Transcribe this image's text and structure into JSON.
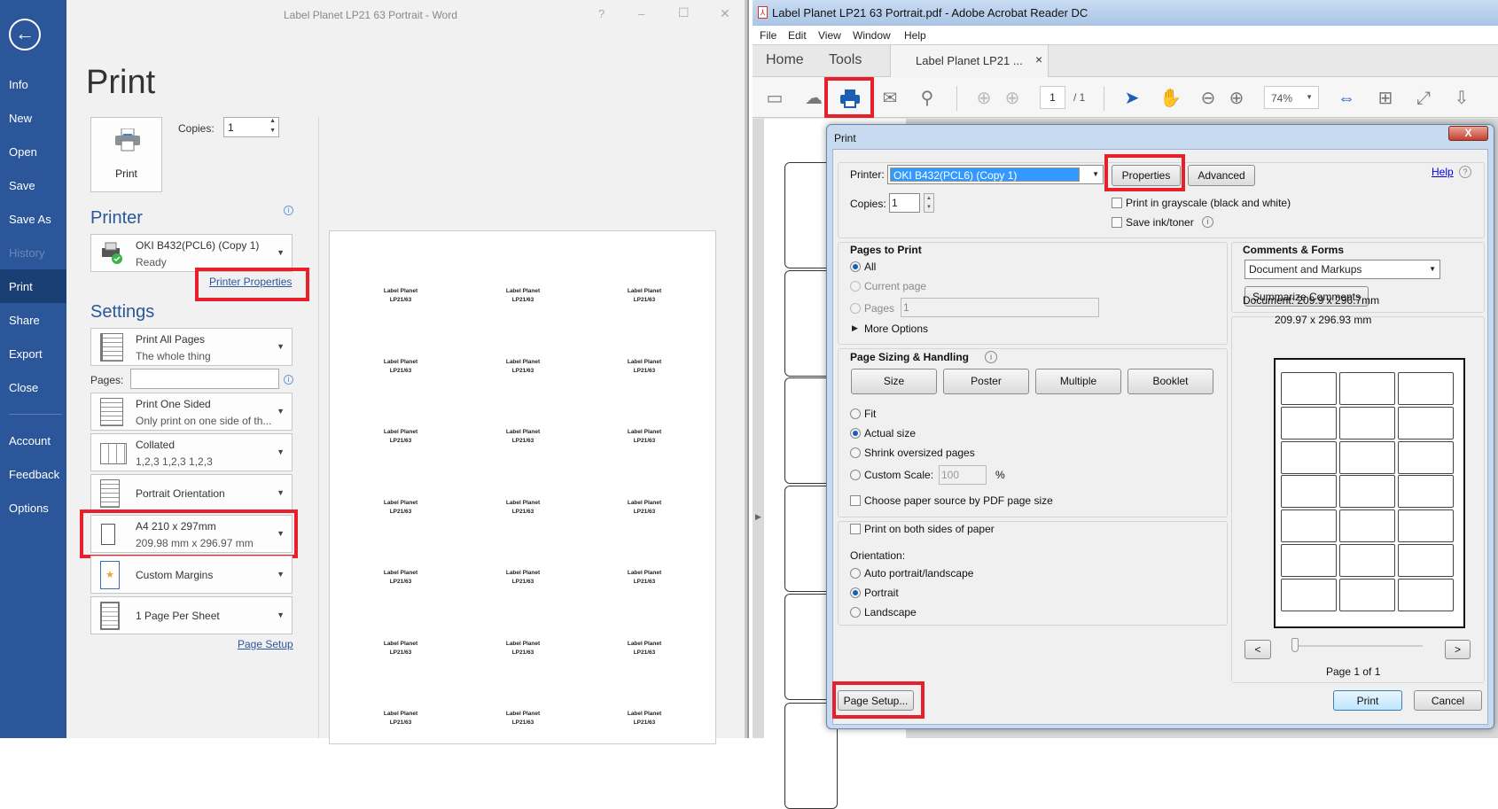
{
  "word": {
    "title": "Label Planet LP21 63 Portrait  -  Word",
    "window_buttons": {
      "help": "?",
      "minimize": "–",
      "maximize": "☐",
      "close": "✕"
    },
    "sidebar": [
      {
        "label": "Info"
      },
      {
        "label": "New"
      },
      {
        "label": "Open"
      },
      {
        "label": "Save"
      },
      {
        "label": "Save As"
      },
      {
        "label": "History"
      },
      {
        "label": "Print"
      },
      {
        "label": "Share"
      },
      {
        "label": "Export"
      },
      {
        "label": "Close"
      },
      {
        "label": "Account"
      },
      {
        "label": "Feedback"
      },
      {
        "label": "Options"
      }
    ],
    "heading": "Print",
    "print_button": "Print",
    "copies_label": "Copies:",
    "copies_value": "1",
    "printer_heading": "Printer",
    "printer_name": "OKI B432(PCL6) (Copy 1)",
    "printer_status": "Ready",
    "printer_properties": "Printer Properties",
    "settings_heading": "Settings",
    "pages_label": "Pages:",
    "pages_value": "",
    "settings": [
      {
        "title": "Print All Pages",
        "sub": "The whole thing"
      },
      {
        "title": "Print One Sided",
        "sub": "Only print on one side of th..."
      },
      {
        "title": "Collated",
        "sub": "1,2,3    1,2,3    1,2,3"
      },
      {
        "title": "Portrait Orientation",
        "sub": ""
      },
      {
        "title": "A4 210 x 297mm",
        "sub": "209.98 mm x 296.97 mm"
      },
      {
        "title": "Custom Margins",
        "sub": ""
      },
      {
        "title": "1 Page Per Sheet",
        "sub": ""
      }
    ],
    "page_setup": "Page Setup",
    "preview_label": {
      "line1": "Label Planet",
      "line2": "LP21/63",
      "rows": 7,
      "cols": 3
    }
  },
  "acrobat": {
    "title": "Label Planet LP21 63 Portrait.pdf - Adobe Acrobat Reader DC",
    "menu": [
      "File",
      "Edit",
      "View",
      "Window",
      "Help"
    ],
    "tabs": {
      "home": "Home",
      "tools": "Tools",
      "doc": "Label Planet LP21 ...",
      "close": "×"
    },
    "page_current": "1",
    "page_total": "/ 1",
    "zoom": "74%",
    "dialog": {
      "title": "Print",
      "close": "X",
      "printer_label": "Printer:",
      "printer_value": "OKI B432(PCL6) (Copy 1)",
      "properties": "Properties",
      "advanced": "Advanced",
      "help": "Help",
      "copies_label": "Copies:",
      "copies_value": "1",
      "grayscale": "Print in grayscale (black and white)",
      "save_ink": "Save ink/toner",
      "pages_to_print": {
        "title": "Pages to Print",
        "all": "All",
        "current": "Current page",
        "pages": "Pages",
        "pages_value": "1",
        "more": "More Options"
      },
      "sizing": {
        "title": "Page Sizing & Handling",
        "buttons": [
          "Size",
          "Poster",
          "Multiple",
          "Booklet"
        ],
        "fit": "Fit",
        "actual": "Actual size",
        "shrink": "Shrink oversized pages",
        "custom": "Custom Scale:",
        "custom_value": "100",
        "percent": "%",
        "paper_source": "Choose paper source by PDF page size"
      },
      "both_sides": "Print on both sides of paper",
      "orientation": {
        "label": "Orientation:",
        "auto": "Auto portrait/landscape",
        "portrait": "Portrait",
        "landscape": "Landscape"
      },
      "comments": {
        "title": "Comments & Forms",
        "value": "Document and Markups",
        "summarize": "Summarize Comments"
      },
      "document_size": "Document: 209.9 x 296.7mm",
      "paper_size": "209.97 x 296.93 mm",
      "prev": "<",
      "next": ">",
      "page_of": "Page 1 of 1",
      "page_setup": "Page Setup...",
      "print": "Print",
      "cancel": "Cancel",
      "preview_grid": {
        "rows": 7,
        "cols": 3
      }
    }
  },
  "colors": {
    "word_blue": "#2b579a",
    "highlight_red": "#e8202a",
    "acrobat_blue": "#1a5fb4"
  }
}
